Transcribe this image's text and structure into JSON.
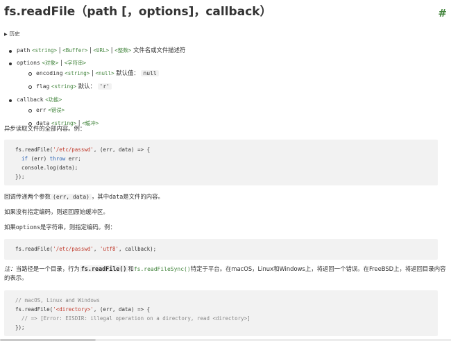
{
  "heading": {
    "title": "fs.readFile（path [，options]，callback）",
    "anchor": "#"
  },
  "history": {
    "label": "历史",
    "icon": "triangle-right-icon"
  },
  "params": {
    "path": {
      "name": "path",
      "types": [
        "<string>",
        "<Buffer>",
        "<URL>",
        "<整数>"
      ],
      "desc": "文件名或文件描述符"
    },
    "options": {
      "name": "options",
      "types": [
        "<对象>",
        "<字符串>"
      ],
      "encoding": {
        "name": "encoding",
        "types": [
          "<string>",
          "<null>"
        ],
        "default_label": "默认值：",
        "default_value": "null"
      },
      "flag": {
        "name": "flag",
        "types": [
          "<string>"
        ],
        "default_label": "默认：",
        "default_value": "'r'"
      }
    },
    "callback": {
      "name": "callback",
      "types": [
        "<功能>"
      ],
      "err": {
        "name": "err",
        "types": [
          "<错误>"
        ]
      },
      "data": {
        "name": "data",
        "types": [
          "<string>",
          "<缓冲>"
        ]
      }
    }
  },
  "separator": "|",
  "p1": "异步读取文件的全部内容。例：",
  "code1": {
    "l1_a": "fs.readFile(",
    "l1_s": "'/etc/passwd'",
    "l1_b": ", (err, data) => {",
    "l2_kw1": "if",
    "l2_a": " (err) ",
    "l2_kw2": "throw",
    "l2_b": " err;",
    "l3": "console.log(data);",
    "l4": "});"
  },
  "p2": {
    "pre": "回调传递两个参数",
    "code": "(err, data)",
    "mid": "，其中",
    "data": "data",
    "post": "是文件的内容。"
  },
  "p3": "如果没有指定编码，则返回原始缓冲区。",
  "p4": {
    "pre": "如果",
    "code": "options",
    "post": "是字符串，则指定编码。例："
  },
  "code2": {
    "a": "fs.readFile(",
    "s1": "'/etc/passwd'",
    "b": ", ",
    "s2": "'utf8'",
    "c": ", callback);"
  },
  "note": {
    "label": "注：",
    "pre": "当路径是一个目录，行为",
    "fn1": "fs.readFile()",
    "and": "和",
    "fn2": "fs.readFileSync()",
    "post": "特定于平台。在macOS，Linux和Windows上，将返回一个错误。在FreeBSD上，将返回目录内容的表示。"
  },
  "code3": {
    "c1": "// macOS, Linux and Windows",
    "l2_a": "fs.readFile(",
    "l2_s": "'<directory>'",
    "l2_b": ", (err, data) => {",
    "c3": "// => [Error: EISDIR: illegal operation on a directory, read <directory>]",
    "l4": "});"
  }
}
